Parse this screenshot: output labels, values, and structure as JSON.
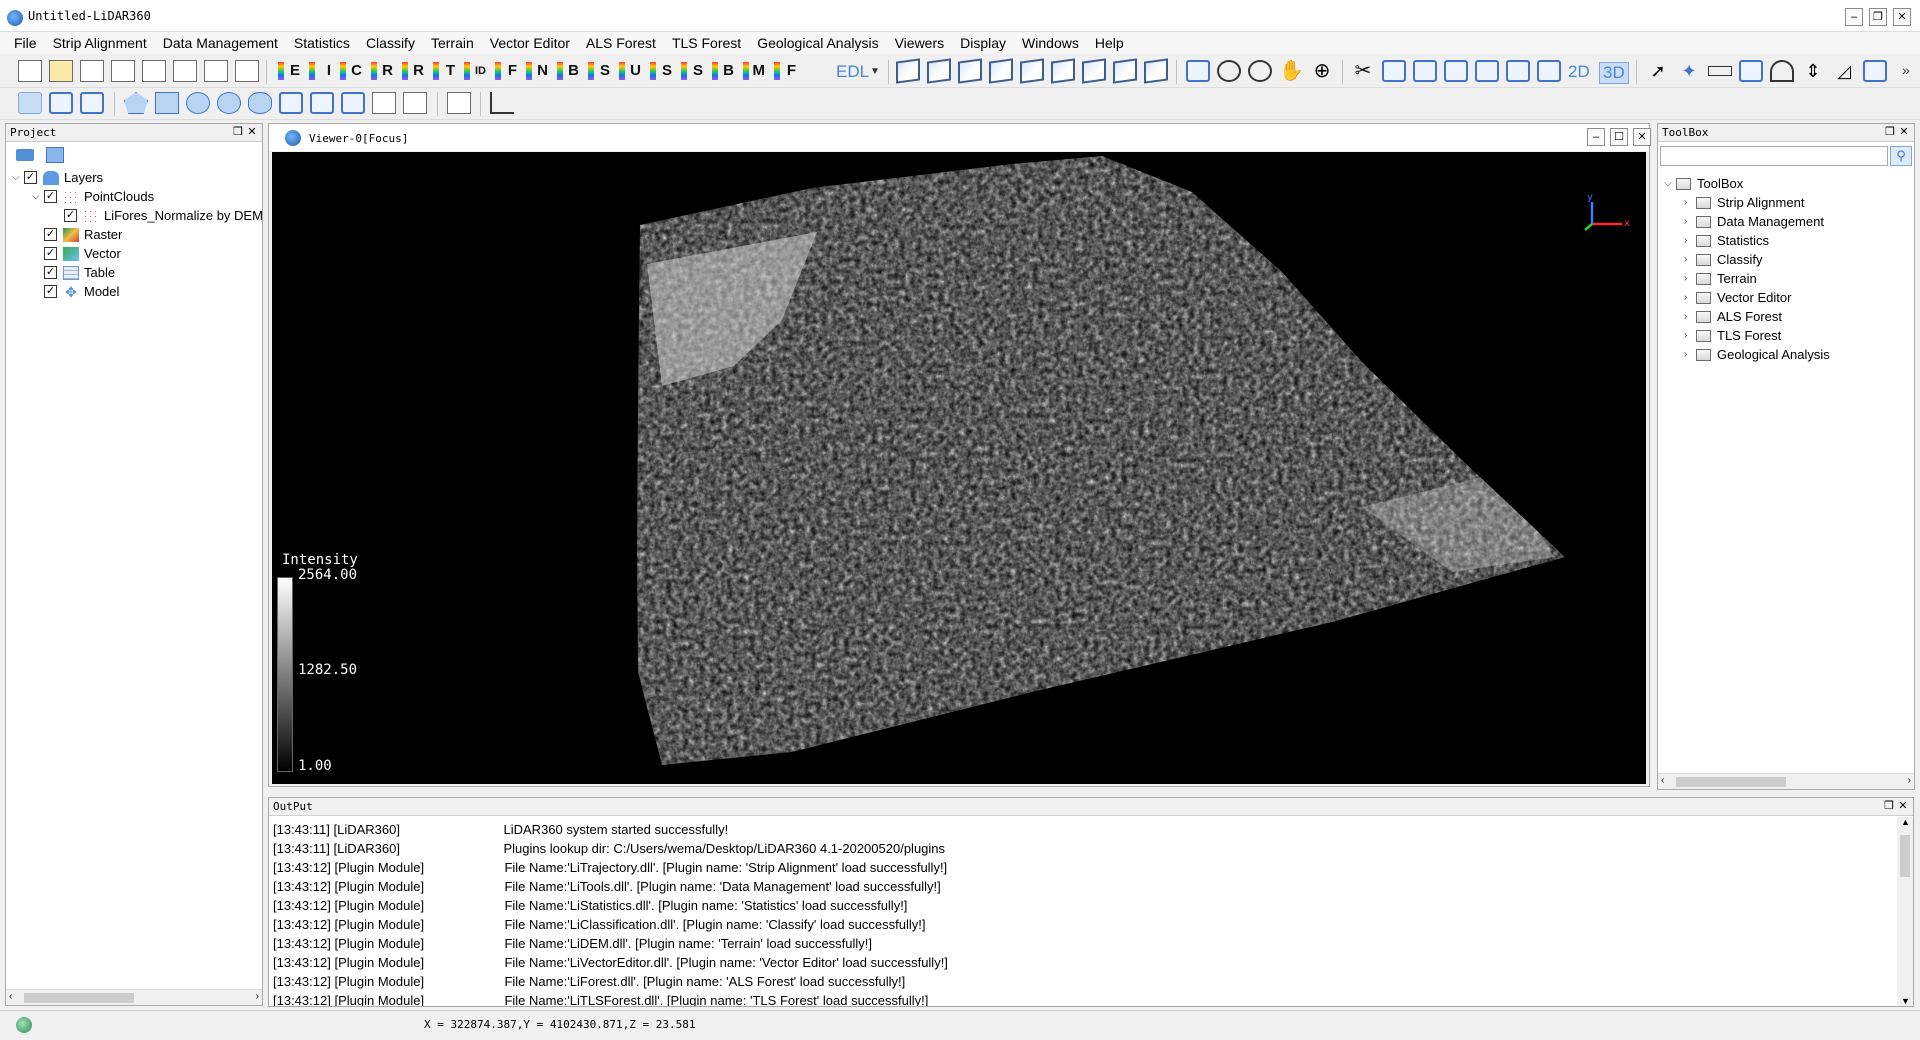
{
  "window": {
    "title": "Untitled-LiDAR360",
    "minimize_label": "–",
    "restore_label": "❐",
    "close_label": "✕"
  },
  "menu": [
    "File",
    "Strip Alignment",
    "Data Management",
    "Statistics",
    "Classify",
    "Terrain",
    "Vector Editor",
    "ALS Forest",
    "TLS Forest",
    "Geological Analysis",
    "Viewers",
    "Display",
    "Windows",
    "Help"
  ],
  "toolbar": {
    "class_labels": [
      "E",
      "I",
      "C",
      "R",
      "R",
      "T",
      "ID",
      "F",
      "N",
      "B",
      "S",
      "U",
      "S",
      "S",
      "B",
      "M",
      "F"
    ],
    "edl_label": "EDL",
    "view2d_label": "2D",
    "view3d_label": "3D",
    "overflow_label": "»"
  },
  "project": {
    "title": "Project",
    "layers_label": "Layers",
    "pointclouds_label": "PointClouds",
    "pointcloud_file": "LiFores_Normalize by DEM",
    "raster_label": "Raster",
    "vector_label": "Vector",
    "table_label": "Table",
    "model_label": "Model",
    "check_mark": "✓"
  },
  "viewer": {
    "title": "Viewer-0[Focus]",
    "legend": {
      "title": "Intensity",
      "max": "2564.00",
      "mid": "1282.50",
      "min": "1.00"
    },
    "axes": {
      "x": "x",
      "y": "y"
    }
  },
  "toolbox": {
    "title": "ToolBox",
    "search_placeholder": "",
    "root_label": "ToolBox",
    "items": [
      "Strip Alignment",
      "Data Management",
      "Statistics",
      "Classify",
      "Terrain",
      "Vector Editor",
      "ALS Forest",
      "TLS Forest",
      "Geological Analysis"
    ]
  },
  "output": {
    "title": "OutPut",
    "lines": [
      {
        "time": "[13:43:11]",
        "module": "[LiDAR360]",
        "message": "LiDAR360 system started successfully!"
      },
      {
        "time": "[13:43:11]",
        "module": "[LiDAR360]",
        "message": "Plugins lookup dir: C:/Users/wema/Desktop/LiDAR360 4.1-20200520/plugins"
      },
      {
        "time": "[13:43:12]",
        "module": "[Plugin Module]",
        "message": "File Name:'LiTrajectory.dll'.   [Plugin name: 'Strip Alignment' load successfully!]"
      },
      {
        "time": "[13:43:12]",
        "module": "[Plugin Module]",
        "message": "File Name:'LiTools.dll'.   [Plugin name: 'Data Management' load successfully!]"
      },
      {
        "time": "[13:43:12]",
        "module": "[Plugin Module]",
        "message": "File Name:'LiStatistics.dll'.   [Plugin name: 'Statistics' load successfully!]"
      },
      {
        "time": "[13:43:12]",
        "module": "[Plugin Module]",
        "message": "File Name:'LiClassification.dll'.   [Plugin name: 'Classify' load successfully!]"
      },
      {
        "time": "[13:43:12]",
        "module": "[Plugin Module]",
        "message": "File Name:'LiDEM.dll'.   [Plugin name: 'Terrain' load successfully!]"
      },
      {
        "time": "[13:43:12]",
        "module": "[Plugin Module]",
        "message": "File Name:'LiVectorEditor.dll'.   [Plugin name: 'Vector Editor' load successfully!]"
      },
      {
        "time": "[13:43:12]",
        "module": "[Plugin Module]",
        "message": "File Name:'LiForest.dll'.   [Plugin name: 'ALS Forest' load successfully!]"
      },
      {
        "time": "[13:43:12]",
        "module": "[Plugin Module]",
        "message": "File Name:'LiTLSForest.dll'.   [Plugin name: 'TLS Forest' load successfully!]"
      }
    ]
  },
  "status": {
    "coordinates": "X = 322874.387,Y = 4102430.871,Z = 23.581"
  },
  "colors": {
    "accent": "#3f74c9",
    "viewer_bg": "#000000"
  }
}
